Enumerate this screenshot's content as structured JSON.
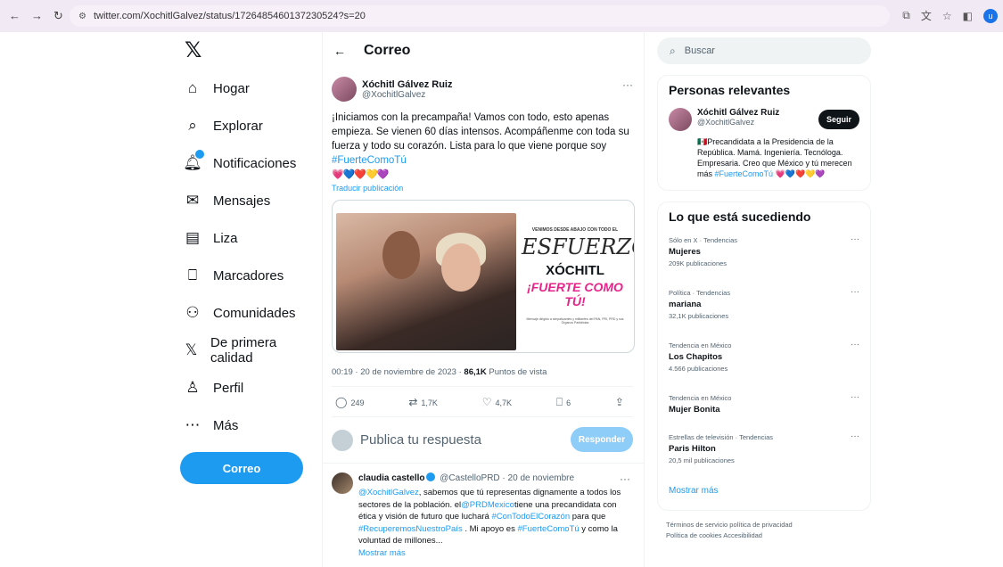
{
  "browser": {
    "url": "twitter.com/XochitlGalvez/status/1726485460137230524?s=20",
    "profile_initial": "u"
  },
  "sidebar": {
    "logo": "𝕏",
    "items": [
      {
        "label": "Hogar",
        "icon": "home-icon",
        "glyph": "⌂"
      },
      {
        "label": "Explorar",
        "icon": "search-icon",
        "glyph": "⌕"
      },
      {
        "label": "Notificaciones",
        "icon": "bell-icon",
        "glyph": "♫"
      },
      {
        "label": "Mensajes",
        "icon": "envelope-icon",
        "glyph": "✉"
      },
      {
        "label": "Liza",
        "icon": "list-icon",
        "glyph": "▤"
      },
      {
        "label": "Marcadores",
        "icon": "bookmark-icon",
        "glyph": "⎕"
      },
      {
        "label": "Comunidades",
        "icon": "people-icon",
        "glyph": "⚇"
      },
      {
        "label": "De primera calidad",
        "icon": "x-premium-icon",
        "glyph": "𝕏"
      },
      {
        "label": "Perfil",
        "icon": "person-icon",
        "glyph": "♙"
      },
      {
        "label": "Más",
        "icon": "more-circle-icon",
        "glyph": "⋯"
      }
    ],
    "post_button": "Correo"
  },
  "main": {
    "header_title": "Correo",
    "tweet": {
      "name": "Xóchitl Gálvez Ruiz",
      "handle": "@XochitlGalvez",
      "text_main": "¡Iniciamos con la precampaña! Vamos con todo, esto apenas empieza. Se vienen 60 días intensos. Acompáñenme con toda su fuerza y todo su corazón. Lista para lo que viene porque soy ",
      "hashtag": "#FuerteComoTú",
      "hearts": "💗💙❤️💛💜",
      "translate": "Traducir publicación",
      "media": {
        "small_text": "VENIMOS DESDE ABAJO CON TODO EL",
        "esfuerzo": "ESFUERZO",
        "xochitl": "XÓCHITL",
        "fuerte": "¡FUERTE COMO TÚ!",
        "fine_print": "Mensaje dirigido a simpatizantes y militantes del PAN, PRI, PRD y sus Órganos Partidistas"
      },
      "time": "00:19 · 20 de noviembre de 2023 · ",
      "views": "86,1K",
      "views_label": " Puntos de vista",
      "stats": {
        "replies": "249",
        "retweets": "1,7K",
        "likes": "4,7K",
        "bookmarks": "6"
      }
    },
    "reply_placeholder": "Publica tu respuesta",
    "reply_button": "Responder",
    "reply": {
      "name": "claudia castello",
      "handle_date": " @CastelloPRD · 20 de noviembre",
      "mention1": "@XochitlGalvez",
      "text1": ", sabemos que tú representas dignamente a todos los sectores de la población. el",
      "mention2": "@PRDMexico",
      "text2": "tiene una precandidata con ética y visión de futuro que luchará ",
      "tag1": "#ConTodoElCorazón",
      "text3": " para que ",
      "tag2": "#RecuperemosNuestroPaís",
      "text4": " . Mi apoyo es ",
      "tag3": "#FuerteComoTú",
      "text5": " y como la voluntad de millones...",
      "show_more": "Mostrar más"
    }
  },
  "right": {
    "search_placeholder": "Buscar",
    "relevant_title": "Personas relevantes",
    "person": {
      "name": "Xóchitl Gálvez Ruiz",
      "handle": "@XochitlGalvez",
      "follow": "Seguir",
      "bio": "🇲🇽Precandidata a la Presidencia de la República. Mamá. Ingeniería. Tecnóloga. Empresaria. Creo que México y tú merecen más ",
      "bio_tag": "#FuerteComoTú",
      "bio_hearts": " 💗💙❤️💛💜"
    },
    "trends_title": "Lo que está sucediendo",
    "trends": [
      {
        "meta": "Sólo en X · Tendencias",
        "name": "Mujeres",
        "count": "209K publicaciones"
      },
      {
        "meta": "Política · Tendencias",
        "name": "mariana",
        "count": "32,1K publicaciones"
      },
      {
        "meta": "Tendencia en México",
        "name": "Los Chapitos",
        "count": "4.566 publicaciones"
      },
      {
        "meta": "Tendencia en México",
        "name": "Mujer Bonita",
        "count": ""
      },
      {
        "meta": "Estrellas de televisión · Tendencias",
        "name": "Paris Hilton",
        "count": "20,5 mil publicaciones"
      }
    ],
    "show_more": "Mostrar más",
    "footer_line1": "Términos de servicio   política de privacidad",
    "footer_line2": "Política de cookies   Accesibilidad"
  }
}
